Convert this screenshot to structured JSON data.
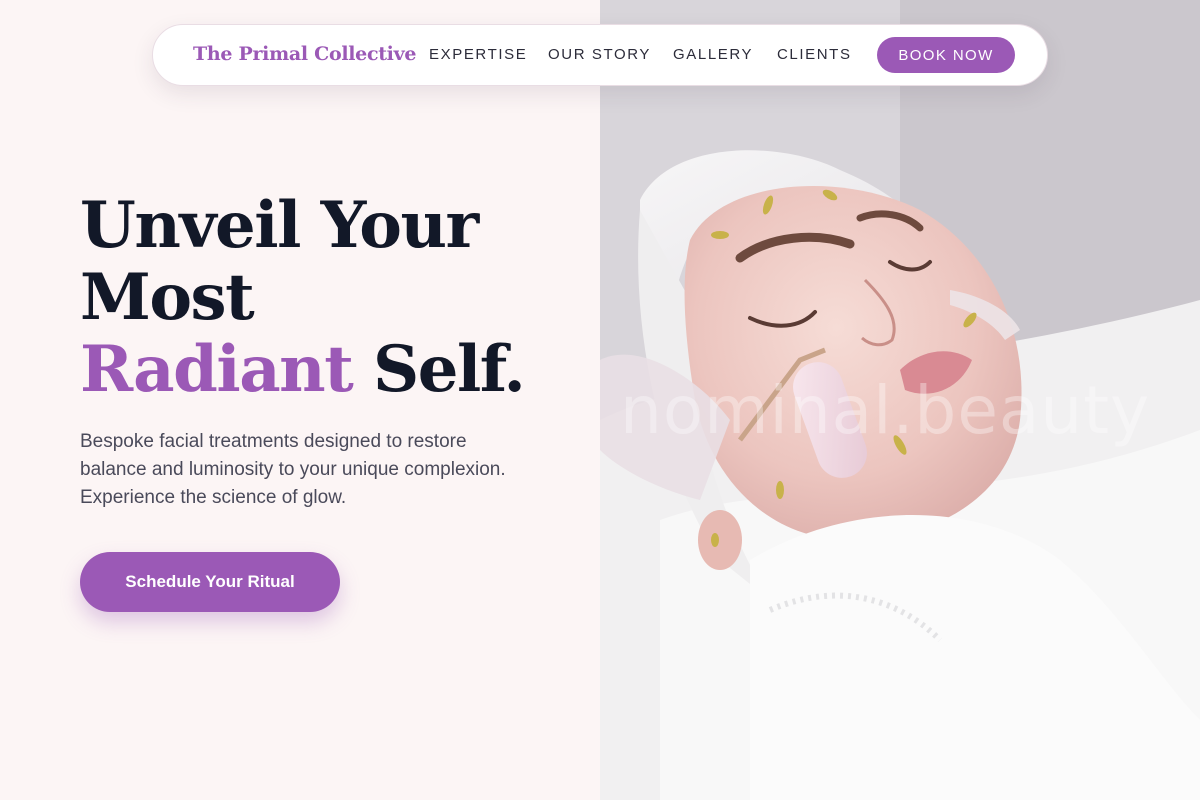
{
  "brand": {
    "name": "The Primal Collective"
  },
  "nav": {
    "links": [
      "EXPERTISE",
      "OUR STORY",
      "GALLERY",
      "CLIENTS"
    ],
    "book_label": "BOOK NOW"
  },
  "hero": {
    "title_line1": "Unveil Your",
    "title_line2": "Most",
    "title_accent": "Radiant",
    "title_end": " Self.",
    "subtitle": "Bespoke facial treatments designed to restore balance and luminosity to your unique complexion. Experience the science of glow.",
    "cta_label": "Schedule Your Ritual",
    "image_watermark": "nominal.beauty"
  },
  "colors": {
    "accent": "#9b59b6",
    "heading": "#121828",
    "body_text": "#4a4a5a",
    "left_background": "#fcf5f5"
  }
}
